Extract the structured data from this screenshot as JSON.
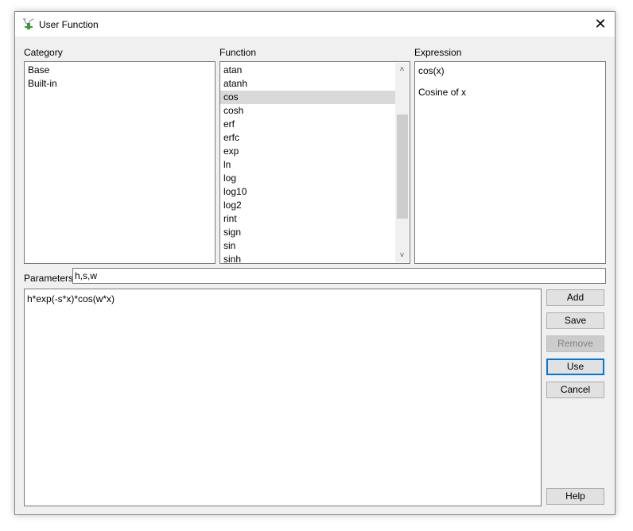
{
  "window": {
    "title": "User Function",
    "icon": "function-plot-icon"
  },
  "category": {
    "label": "Category",
    "items": [
      "Base",
      "Built-in"
    ]
  },
  "function": {
    "label": "Function",
    "items": [
      "atan",
      "atanh",
      "cos",
      "cosh",
      "erf",
      "erfc",
      "exp",
      "ln",
      "log",
      "log10",
      "log2",
      "rint",
      "sign",
      "sin",
      "sinh"
    ],
    "selected": "cos"
  },
  "expression": {
    "label": "Expression",
    "formula": "cos(x)",
    "description": "Cosine of x"
  },
  "parameters": {
    "label": "Parameters",
    "value": "h,s,w"
  },
  "editor": {
    "value": "h*exp(-s*x)*cos(w*x)"
  },
  "buttons": {
    "add": "Add",
    "save": "Save",
    "remove": "Remove",
    "use": "Use",
    "cancel": "Cancel",
    "help": "Help"
  }
}
